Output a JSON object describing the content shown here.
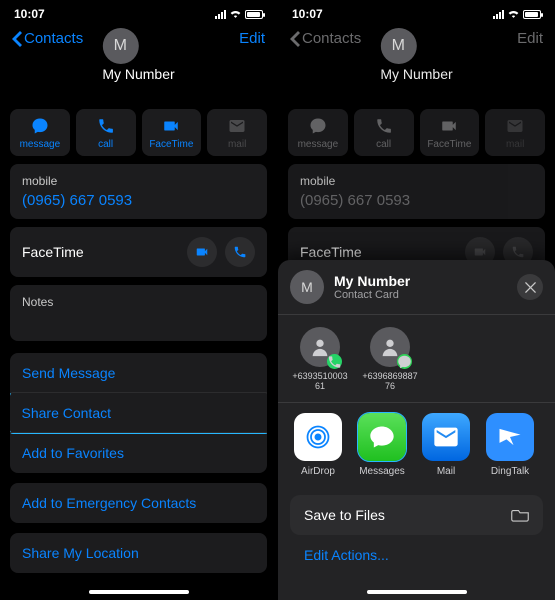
{
  "status": {
    "time": "10:07"
  },
  "nav": {
    "back": "Contacts",
    "edit": "Edit"
  },
  "contact": {
    "initial": "M",
    "name": "My Number"
  },
  "actions": {
    "message": "message",
    "call": "call",
    "facetime": "FaceTime",
    "mail": "mail"
  },
  "phone_card": {
    "label": "mobile",
    "value": "(0965) 667 0593"
  },
  "facetime_card": {
    "label": "FaceTime"
  },
  "notes_card": {
    "label": "Notes"
  },
  "list": {
    "send_message": "Send Message",
    "share_contact": "Share Contact",
    "add_favorites": "Add to Favorites"
  },
  "add_emergency": "Add to Emergency Contacts",
  "share_location": "Share My Location",
  "share_sheet": {
    "title": "My Number",
    "subtitle": "Contact Card",
    "people": [
      {
        "number": "+6393510003\n61",
        "badge": "wa"
      },
      {
        "number": "+6396869887\n76",
        "badge": "msg"
      }
    ],
    "apps": {
      "airdrop": "AirDrop",
      "messages": "Messages",
      "mail": "Mail",
      "dingtalk": "DingTalk"
    },
    "save_files": "Save to Files",
    "edit_actions": "Edit Actions..."
  }
}
